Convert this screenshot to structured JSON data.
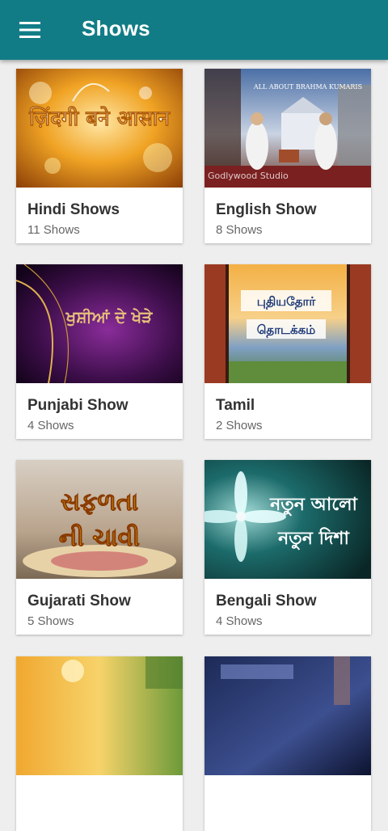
{
  "appbar": {
    "title": "Shows",
    "color": "#127c86"
  },
  "cards": [
    {
      "title": "Hindi Shows",
      "count": "11 Shows",
      "art_text": "ज़िंदगी बने आसान"
    },
    {
      "title": "English Show",
      "count": "8 Shows",
      "art_text": "ALL ABOUT BRAHMA KUMARIS",
      "watermark": "Godlywood Studio"
    },
    {
      "title": "Punjabi Show",
      "count": "4 Shows",
      "art_text": "ਖੁਸ਼ੀਆਂ ਦੇ ਖੇੜੇ"
    },
    {
      "title": "Tamil",
      "count": "2 Shows",
      "art_text_1": "புதியதோர்",
      "art_text_2": "தொடக்கம்"
    },
    {
      "title": "Gujarati Show",
      "count": "5 Shows",
      "art_text_1": "સફળતા",
      "art_text_2": "ની ચાવી"
    },
    {
      "title": "Bengali Show",
      "count": "4 Shows",
      "art_text_1": "নতুন আলো",
      "art_text_2": "নতুন দিশা"
    },
    {
      "title": "",
      "count": ""
    },
    {
      "title": "",
      "count": ""
    }
  ]
}
